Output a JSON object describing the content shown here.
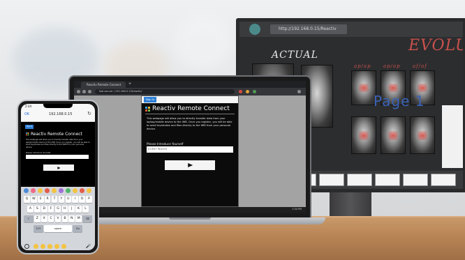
{
  "monitor": {
    "url": "http://192.168.0.15/Reactiv",
    "heading_left": "ACTUAL",
    "heading_right": "EVOLU",
    "page_label": "Page 1",
    "column_labels": [
      "ap/ap",
      "ap/ap",
      "af/af"
    ]
  },
  "laptop": {
    "tab_title": "Reactiv Remote Connect",
    "new_tab": "+",
    "url": "Not secure | 192.168.0.15/reactiv/",
    "page": {
      "signin_label": "Sign In",
      "title": "Reactiv Remote Connect",
      "body": "This webpage will allow you to directly transfer data from your laptop/mobile device to the IWB. Once you register, you will be able to send keystrokes and files directly to the IWB from your personal device.",
      "prompt": "Please Introduce Yourself",
      "input_placeholder": "Enter Name"
    },
    "taskbar_time": "2:34 PM"
  },
  "phone": {
    "status_time": "2:34",
    "ok_label": "OK",
    "url": "192.168.0.15",
    "page": {
      "signin_label": "Sign In",
      "title": "Reactiv Remote Connect",
      "body": "This webpage will allow you to directly transfer data from your laptop/mobile device to the IWB. Once you register, you will be able to send keystrokes and files directly to the IWB from your personal device.",
      "prompt": "Please Introduce Yourself"
    },
    "keyboard": {
      "row1": [
        "Q",
        "W",
        "E",
        "R",
        "T",
        "Y",
        "U",
        "I",
        "O",
        "P"
      ],
      "row2": [
        "A",
        "S",
        "D",
        "F",
        "G",
        "H",
        "J",
        "K",
        "L"
      ],
      "row3": [
        "Z",
        "X",
        "C",
        "V",
        "B",
        "N",
        "M"
      ],
      "num_label": "123",
      "space_label": "space",
      "go_label": "Go"
    }
  },
  "colors": {
    "accent": "#2d7fd6",
    "annotation_red": "#c9514c",
    "page_blue": "#3b63b8"
  }
}
